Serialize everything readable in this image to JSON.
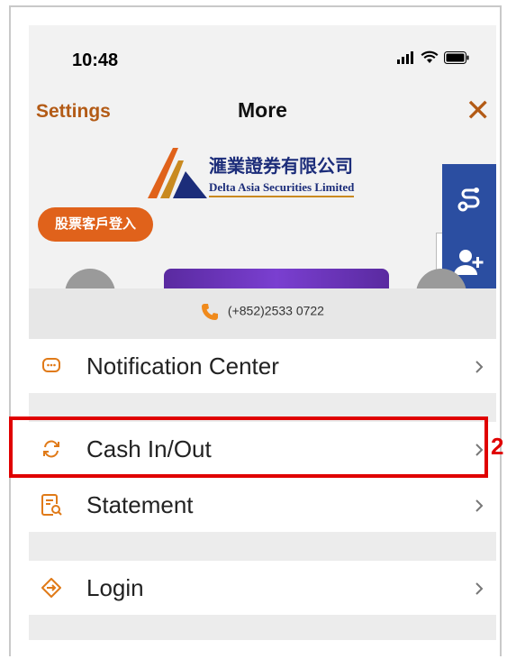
{
  "status_bar": {
    "time": "10:48"
  },
  "nav": {
    "back_label": "Settings",
    "title": "More",
    "close_icon": "close-icon"
  },
  "banner": {
    "logo_cn": "滙業證券有限公司",
    "logo_en": "Delta Asia Securities Limited",
    "login_button": "股票客戶登入"
  },
  "contact": {
    "phone": "(+852)2533 0722"
  },
  "menu": [
    {
      "label": "Notification Center",
      "icon": "message-icon"
    },
    {
      "label": "Cash In/Out",
      "icon": "transfer-icon"
    },
    {
      "label": "Statement",
      "icon": "statement-icon"
    },
    {
      "label": "Login",
      "icon": "login-icon"
    }
  ],
  "annotation": {
    "badge": "2"
  },
  "colors": {
    "accent": "#b35b16",
    "brand_blue": "#1c2d7a",
    "pill": "#e0621b",
    "highlight": "#e00000"
  }
}
